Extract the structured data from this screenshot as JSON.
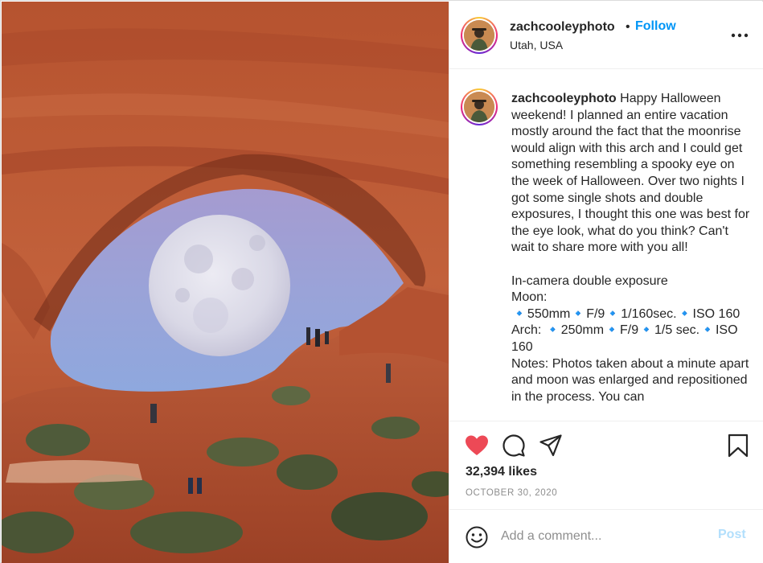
{
  "post": {
    "username": "zachcooleyphoto",
    "follow_label": "Follow",
    "separator": "•",
    "location": "Utah, USA",
    "more_icon": "more-horizontal-icon",
    "caption_text": "Happy Halloween weekend! I planned an entire vacation mostly around the fact that the moonrise would align with this arch and I could get something resembling a spooky eye on the week of Halloween. Over two nights I got some single shots and double exposures, I thought this one was best for the eye look, what do you think? Can't wait to share more with you all!\n\nIn-camera double exposure\nMoon:\n🔹550mm🔹F/9🔹1/160sec.🔹ISO 160\nArch: 🔹250mm🔹F/9🔹1/5 sec.🔹ISO 160\nNotes: Photos taken about a minute apart and moon was enlarged and repositioned in the process. You can",
    "likes": "32,394 likes",
    "date": "OCTOBER 30, 2020",
    "liked": true
  },
  "actions": {
    "like_icon": "heart-icon",
    "comment_icon": "comment-icon",
    "share_icon": "share-icon",
    "save_icon": "bookmark-icon"
  },
  "composer": {
    "placeholder": "Add a comment...",
    "post_label": "Post",
    "emoji_icon": "emoji-icon"
  },
  "colors": {
    "accent": "#0095f6",
    "heart": "#ed4956",
    "post_disabled": "#b2dffc",
    "muted": "#8e8e8e"
  }
}
